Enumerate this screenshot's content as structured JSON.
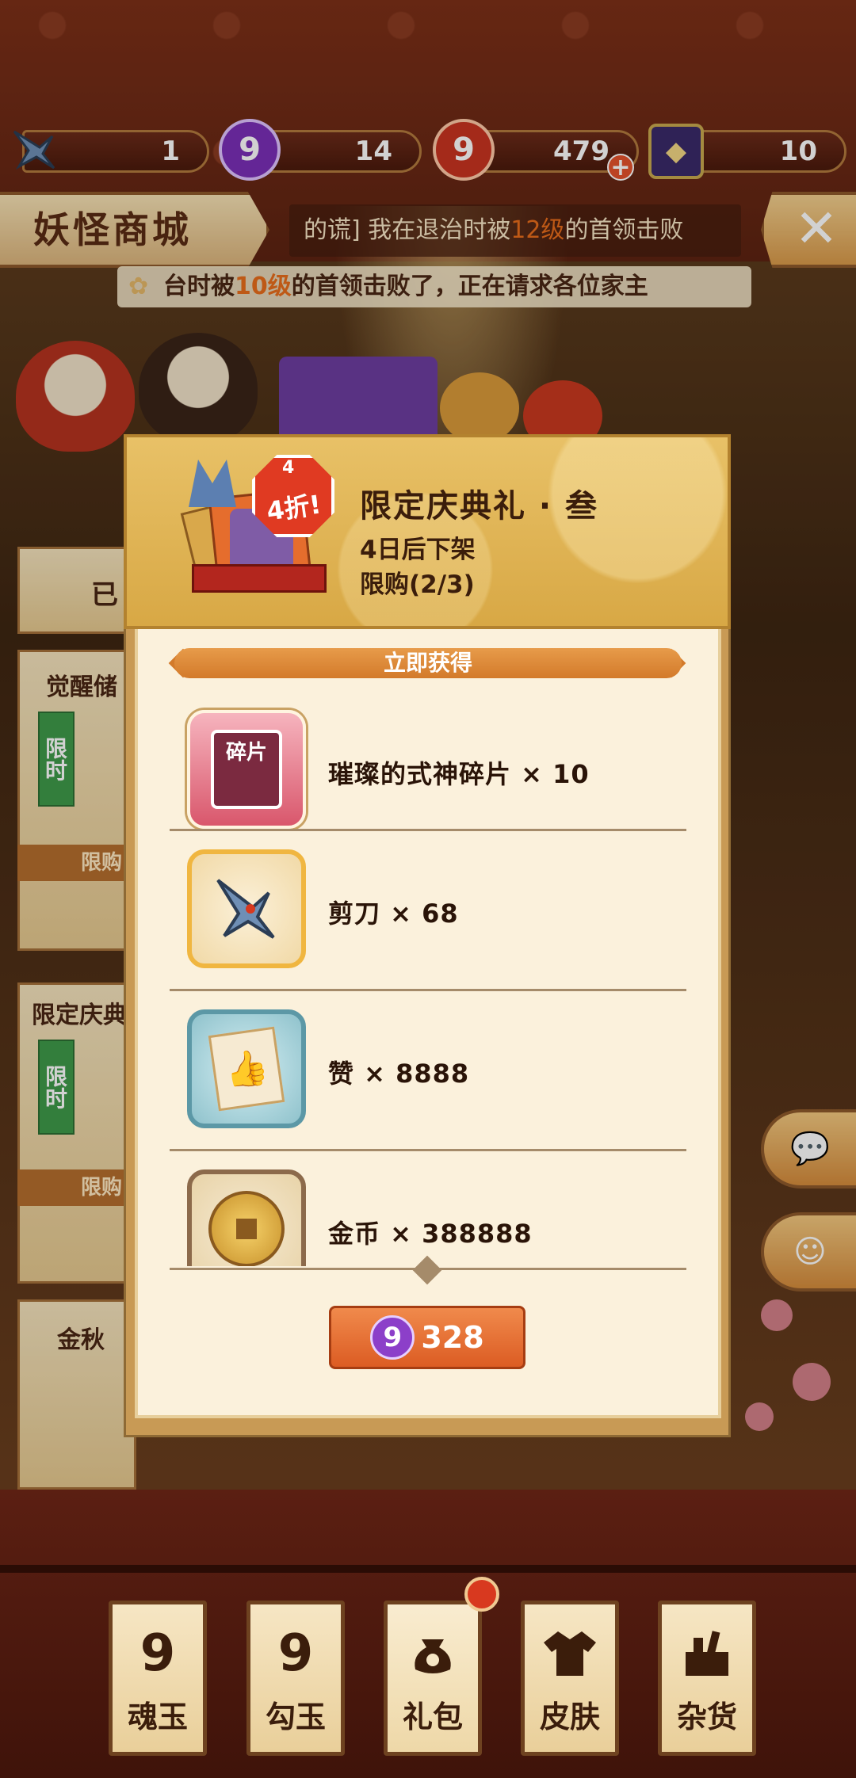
{
  "resources": [
    {
      "icon": "scissors-icon",
      "value": "1"
    },
    {
      "icon": "purple-magatama-icon",
      "value": "14"
    },
    {
      "icon": "red-magatama-icon",
      "value": "479"
    },
    {
      "icon": "ticket-icon",
      "value": "10"
    }
  ],
  "header": {
    "title": "妖怪商城",
    "marquee1_prefix": "的谎] 我在退治时被",
    "marquee1_level": "12级",
    "marquee1_suffix": "的首领击败",
    "marquee2_prefix": "台时被",
    "marquee2_level": "10级",
    "marquee2_suffix": "的首领击败了，正在请求各位家主"
  },
  "background_cards": {
    "card1_partial": "已",
    "card2_title": "觉醒储",
    "card2_tag": "限时",
    "card2_limit": "限购(",
    "card3_title": "限定庆典",
    "card3_tag": "限时",
    "card3_limit": "限购(",
    "card4_title": "金秋"
  },
  "modal": {
    "badge_top": "4",
    "badge_text": "4折!",
    "title": "限定庆典礼 · 叁",
    "expire": "4日后下架",
    "limit": "限购(2/3)",
    "section_title": "立即获得",
    "items": [
      {
        "icon": "shikigami-fragment-icon",
        "icon_label": "碎片",
        "text": "璀璨的式神碎片 × 10"
      },
      {
        "icon": "scissors-icon",
        "text": "剪刀 × 68"
      },
      {
        "icon": "like-card-icon",
        "text": "赞 × 8888"
      },
      {
        "icon": "gold-coin-icon",
        "text": "金币 × 388888"
      }
    ],
    "price": "328",
    "price_currency_icon": "purple-magatama-icon"
  },
  "tabs": [
    {
      "label": "魂玉",
      "icon": "magatama-outline-icon"
    },
    {
      "label": "勾玉",
      "icon": "magatama-outline-icon"
    },
    {
      "label": "礼包",
      "icon": "gift-bag-icon",
      "selected": true
    },
    {
      "label": "皮肤",
      "icon": "kimono-icon"
    },
    {
      "label": "杂货",
      "icon": "goods-box-icon"
    }
  ],
  "colors": {
    "accent_orange": "#dc5c23",
    "highlight_level": "#e86d1c",
    "magatama_purple": "#8c3fc9",
    "magatama_red": "#d8391f",
    "limit_green": "#3f9a4a"
  }
}
